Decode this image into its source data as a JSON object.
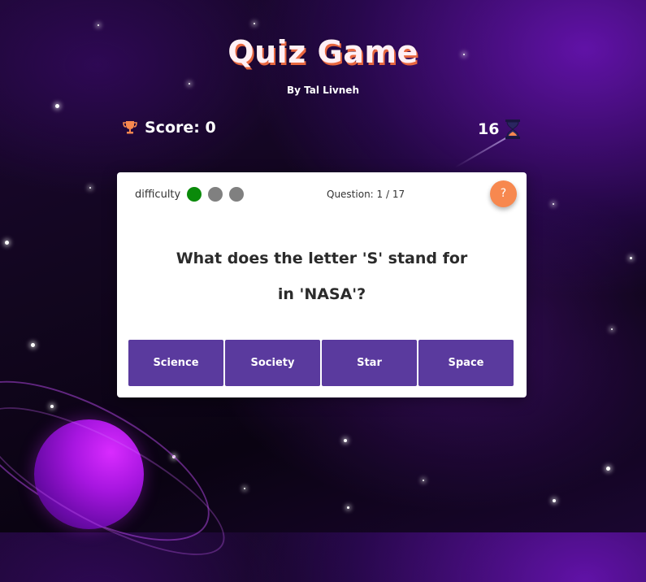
{
  "header": {
    "title": "Quiz Game",
    "byline": "By Tal Livneh"
  },
  "score": {
    "label": "Score: 0",
    "icon": "trophy-icon"
  },
  "timer": {
    "seconds": "16",
    "icon": "hourglass-icon"
  },
  "card": {
    "difficulty_label": "difficulty",
    "difficulty_level": 1,
    "difficulty_max": 3,
    "question_counter": "Question: 1 / 17",
    "help_label": "?",
    "question_line1": "What does the letter 'S' stand for",
    "question_line2": "in 'NASA'?",
    "answers": [
      "Science",
      "Society",
      "Star",
      "Space"
    ]
  },
  "colors": {
    "accent": "#5a3a9e",
    "help": "#f7884f",
    "difficulty_active": "#0a8a0a",
    "difficulty_inactive": "#808080",
    "title_shadow": "#e8673f"
  }
}
